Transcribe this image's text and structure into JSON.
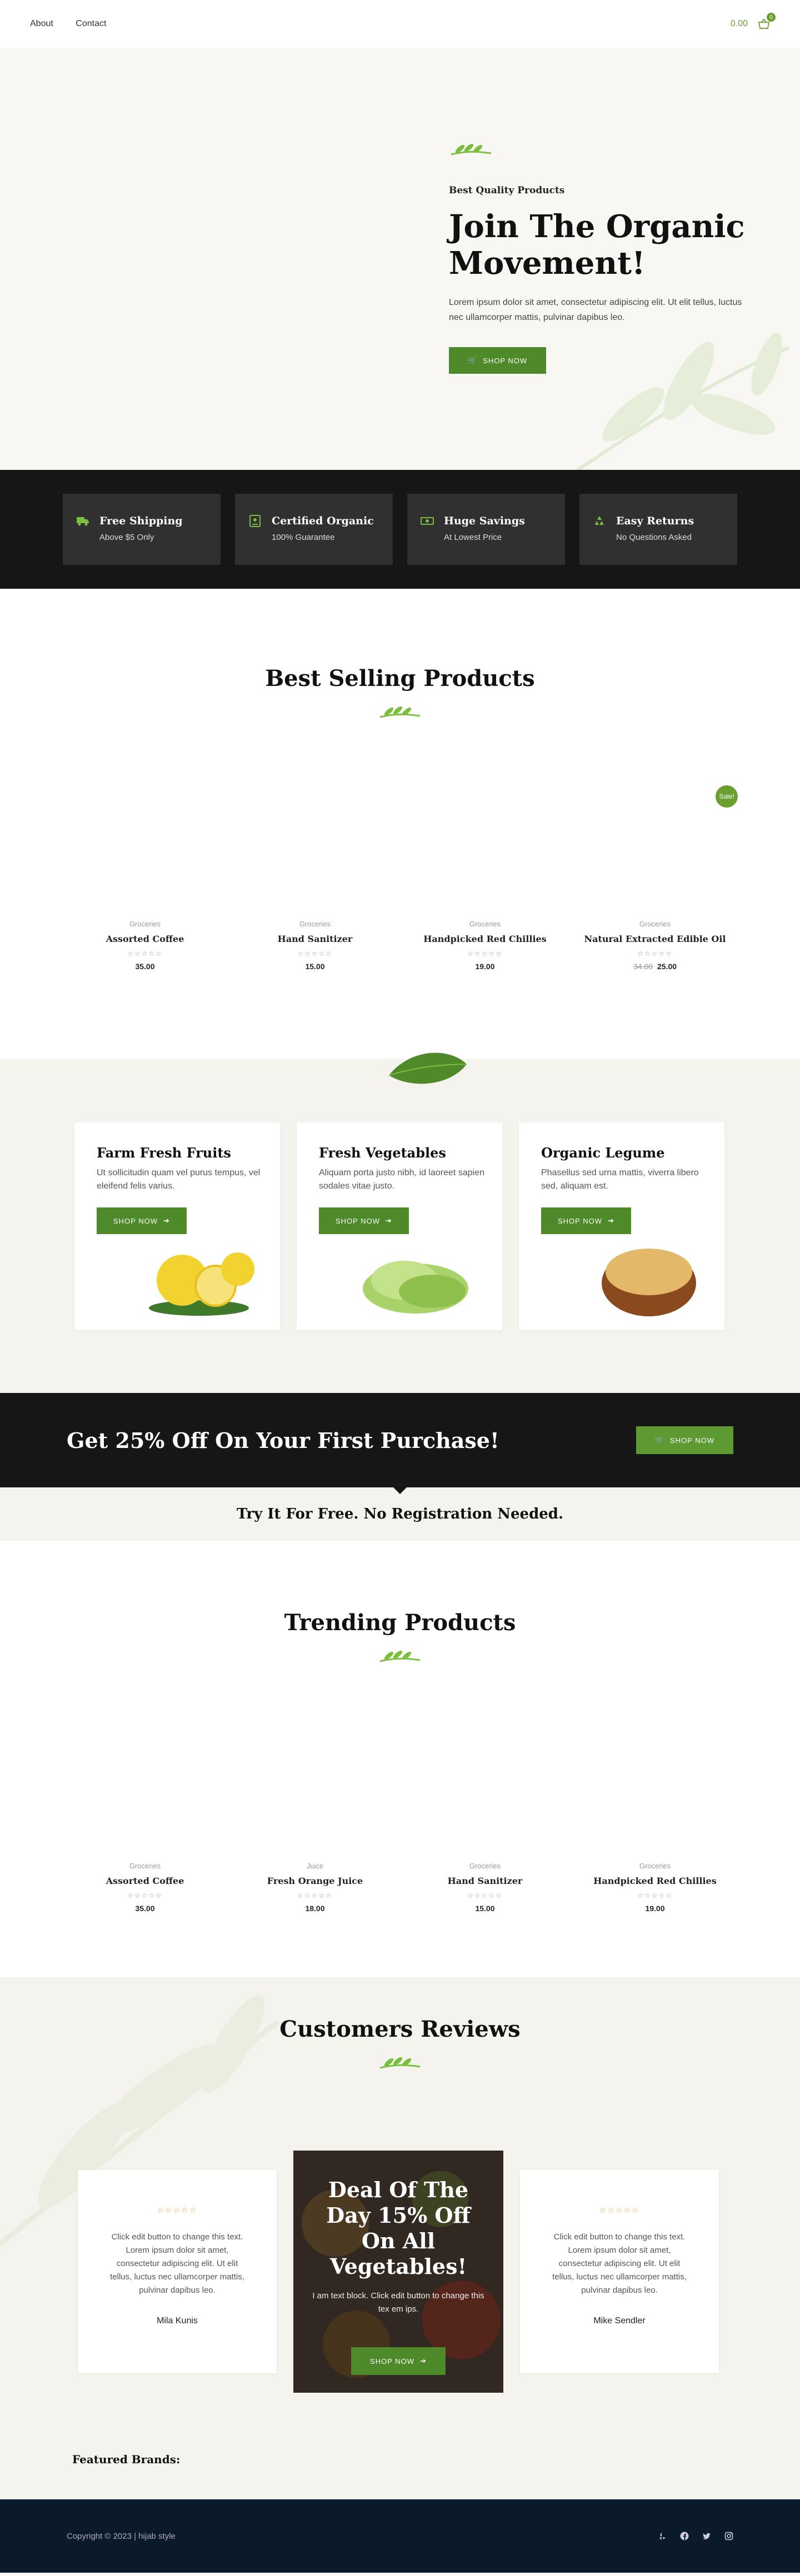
{
  "header": {
    "nav": [
      "About",
      "Contact"
    ],
    "cart_total": "0.00",
    "cart_count": "0"
  },
  "hero": {
    "kicker": "Best Quality Products",
    "title": "Join The Organic Movement!",
    "text": "Lorem ipsum dolor sit amet, consectetur adipiscing elit. Ut elit tellus, luctus nec ullamcorper mattis, pulvinar dapibus leo.",
    "button": "SHOP NOW"
  },
  "features": [
    {
      "icon": "truck-icon",
      "title": "Free Shipping",
      "sub": "Above $5 Only"
    },
    {
      "icon": "certificate-icon",
      "title": "Certified Organic",
      "sub": "100% Guarantee"
    },
    {
      "icon": "money-icon",
      "title": "Huge Savings",
      "sub": "At Lowest Price"
    },
    {
      "icon": "recycle-icon",
      "title": "Easy Returns",
      "sub": "No Questions Asked"
    }
  ],
  "best_selling": {
    "title": "Best Selling Products",
    "sale_badge": "Sale!",
    "products": [
      {
        "category": "Groceries",
        "name": "Assorted Coffee",
        "old_price": "",
        "price": "35.00"
      },
      {
        "category": "Groceries",
        "name": "Hand Sanitizer",
        "old_price": "",
        "price": "15.00"
      },
      {
        "category": "Groceries",
        "name": "Handpicked Red Chillies",
        "old_price": "",
        "price": "19.00"
      },
      {
        "category": "Groceries",
        "name": "Natural Extracted Edible Oil",
        "old_price": "34.00",
        "price": "25.00"
      }
    ],
    "stars": "☆☆☆☆☆"
  },
  "categories": [
    {
      "title": "Farm Fresh Fruits",
      "text": "Ut sollicitudin quam vel purus tempus, vel eleifend felis varius.",
      "button": "SHOP NOW"
    },
    {
      "title": "Fresh Vegetables",
      "text": "Aliquam porta justo nibh, id laoreet sapien sodales vitae justo.",
      "button": "SHOP NOW"
    },
    {
      "title": "Organic Legume",
      "text": "Phasellus sed urna mattis, viverra libero sed, aliquam est.",
      "button": "SHOP NOW"
    }
  ],
  "promo": {
    "title": "Get 25% Off On Your First Purchase!",
    "button": "SHOP NOW",
    "try": "Try It For Free. No Registration Needed."
  },
  "trending": {
    "title": "Trending Products",
    "products": [
      {
        "category": "Groceries",
        "name": "Assorted Coffee",
        "price": "35.00"
      },
      {
        "category": "Juice",
        "name": "Fresh Orange Juice",
        "price": "18.00"
      },
      {
        "category": "Groceries",
        "name": "Hand Sanitizer",
        "price": "15.00"
      },
      {
        "category": "Groceries",
        "name": "Handpicked Red Chillies",
        "price": "19.00"
      }
    ]
  },
  "reviews": {
    "title": "Customers Reviews",
    "stars": "☆☆☆☆☆",
    "cards": [
      {
        "text": "Click edit button to change this text. Lorem ipsum dolor sit amet, consectetur adipiscing elit. Ut elit tellus, luctus nec ullamcorper mattis, pulvinar dapibus leo.",
        "name": "Mila Kunis"
      },
      {
        "text": "Click edit button to change this text. Lorem ipsum dolor sit amet, consectetur adipiscing elit. Ut elit tellus, luctus nec ullamcorper mattis, pulvinar dapibus leo.",
        "name": "Mike Sendler"
      }
    ],
    "deal": {
      "title": "Deal Of The Day 15% Off On All Vegetables!",
      "text": "I am text block. Click edit button to change this tex em ips.",
      "button": "SHOP NOW"
    },
    "brands_label": "Featured Brands:"
  },
  "footer": {
    "copyright": "Copyright © 2023 | hijab style",
    "social": [
      "yelp-icon",
      "facebook-icon",
      "twitter-icon",
      "instagram-icon"
    ]
  },
  "colors": {
    "accent": "#4f8a2a",
    "accent_light": "#7bbf3e",
    "dark": "#161616",
    "footer": "#0b1a2b",
    "cream": "#f5f3ee"
  }
}
